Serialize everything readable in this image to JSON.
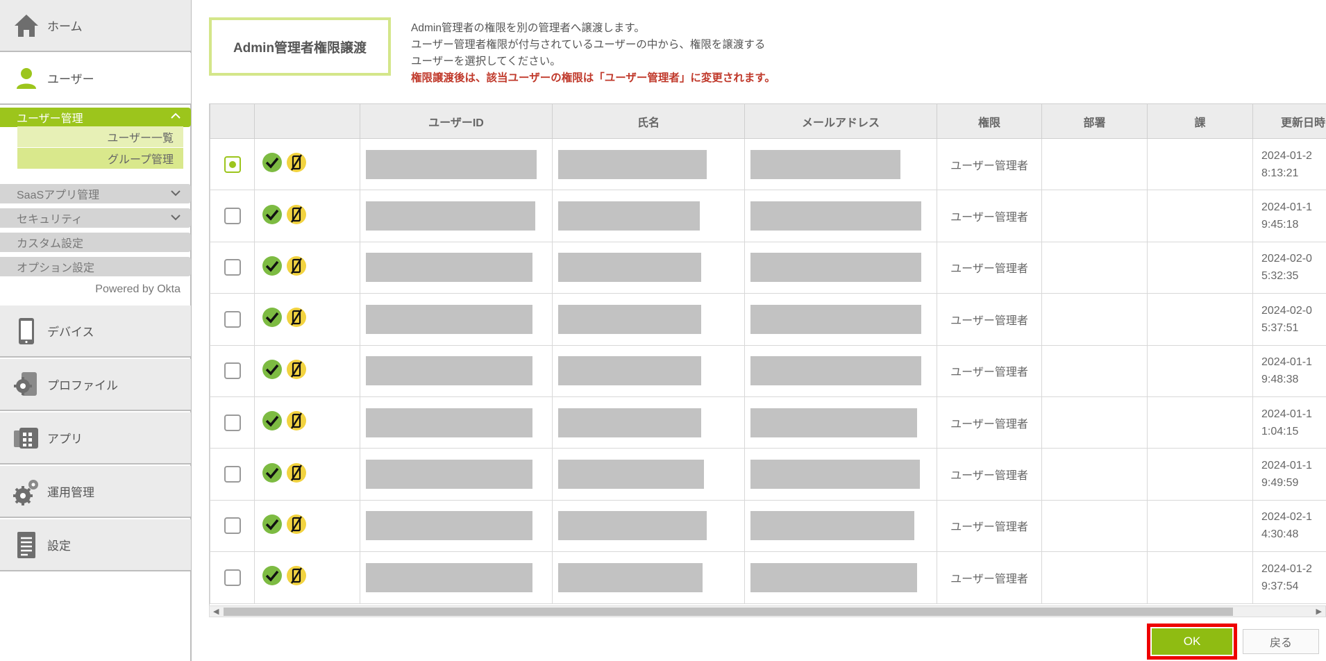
{
  "sidebar": {
    "nav": [
      {
        "label": "ホーム",
        "icon": "home-icon"
      },
      {
        "label": "ユーザー",
        "icon": "user-icon"
      },
      {
        "label": "デバイス",
        "icon": "smartphone-icon"
      },
      {
        "label": "プロファイル",
        "icon": "profile-gear-icon"
      },
      {
        "label": "アプリ",
        "icon": "app-stack-icon"
      },
      {
        "label": "運用管理",
        "icon": "gears-icon"
      },
      {
        "label": "設定",
        "icon": "document-icon"
      }
    ],
    "user_submenu": {
      "active_label": "ユーザー管理",
      "children": [
        "ユーザー一覧",
        "グループ管理"
      ],
      "items": [
        "SaaSアプリ管理",
        "セキュリティ",
        "カスタム設定",
        "オプション設定"
      ]
    },
    "powered_by": "Powered by Okta"
  },
  "header": {
    "title": "Admin管理者権限譲渡",
    "desc_lines": [
      "Admin管理者の権限を別の管理者へ譲渡します。",
      "ユーザー管理者権限が付与されているユーザーの中から、権限を譲渡する",
      "ユーザーを選択してください。"
    ],
    "warning": "権限譲渡後は、該当ユーザーの権限は「ユーザー管理者」に変更されます。"
  },
  "table": {
    "columns": [
      "",
      "",
      "ユーザーID",
      "氏名",
      "メールアドレス",
      "権限",
      "部署",
      "課",
      "更新日時"
    ],
    "rows": [
      {
        "selected": true,
        "role": "ユーザー管理者",
        "date1": "2024-01-2",
        "date2": "8:13:21"
      },
      {
        "selected": false,
        "role": "ユーザー管理者",
        "date1": "2024-01-1",
        "date2": "9:45:18"
      },
      {
        "selected": false,
        "role": "ユーザー管理者",
        "date1": "2024-02-0",
        "date2": "5:32:35"
      },
      {
        "selected": false,
        "role": "ユーザー管理者",
        "date1": "2024-02-0",
        "date2": "5:37:51"
      },
      {
        "selected": false,
        "role": "ユーザー管理者",
        "date1": "2024-01-1",
        "date2": "9:48:38"
      },
      {
        "selected": false,
        "role": "ユーザー管理者",
        "date1": "2024-01-1",
        "date2": "1:04:15"
      },
      {
        "selected": false,
        "role": "ユーザー管理者",
        "date1": "2024-01-1",
        "date2": "9:49:59"
      },
      {
        "selected": false,
        "role": "ユーザー管理者",
        "date1": "2024-02-1",
        "date2": "4:30:48"
      },
      {
        "selected": false,
        "role": "ユーザー管理者",
        "date1": "2024-01-2",
        "date2": "9:37:54"
      }
    ]
  },
  "buttons": {
    "ok": "OK",
    "back": "戻る"
  },
  "colors": {
    "accent": "#9cc51c",
    "warning": "#c0392b",
    "highlight": "#ee0000"
  }
}
